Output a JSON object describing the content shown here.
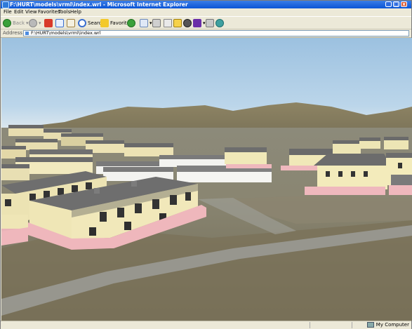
{
  "window": {
    "title": "F:\\HURT\\models\\vrml\\index.wrl - Microsoft Internet Explorer"
  },
  "menu": [
    "File",
    "Edit",
    "View",
    "Favorites",
    "Tools",
    "Help"
  ],
  "toolbar": {
    "back_label": "Back",
    "search_label": "Search",
    "favorites_label": "Favorites"
  },
  "address": {
    "label": "Address",
    "value": "F:\\HURT\\models\\vrml\\index.wrl"
  },
  "status": {
    "zone": "My Computer"
  },
  "colors": {
    "titlebar": "#0a54d6",
    "sky": "#a9c9e4",
    "building_wall": "#f1e9b6",
    "building_roof": "#707070",
    "building_base": "#f0bcc0"
  }
}
